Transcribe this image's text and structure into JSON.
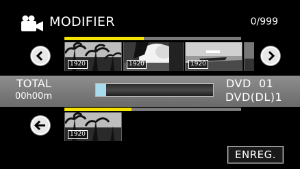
{
  "header": {
    "title": "MODIFIER",
    "counter": "0/999",
    "icon": "video-camera-icon"
  },
  "source_strip": {
    "selected_fraction": 0.45,
    "thumbnails": [
      {
        "tag": "1920"
      },
      {
        "tag": "1920"
      },
      {
        "tag": "1920"
      }
    ],
    "prev_icon": "chevron-left-icon",
    "next_icon": "chevron-right-icon"
  },
  "info": {
    "total_label": "TOTAL",
    "total_time": "00h00m",
    "capacity_fraction": 0.09,
    "disc_line1": "DVD  01",
    "disc_line2": "DVD(DL)1"
  },
  "dest_strip": {
    "selected_fraction": 0.38,
    "thumbnails": [
      {
        "tag": "1920"
      }
    ],
    "back_icon": "back-arrow-icon"
  },
  "footer": {
    "save_label": "ENREG."
  },
  "colors": {
    "highlight": "#f2e300",
    "band": "#7d7d7d",
    "capacity": "#a8dcec"
  }
}
